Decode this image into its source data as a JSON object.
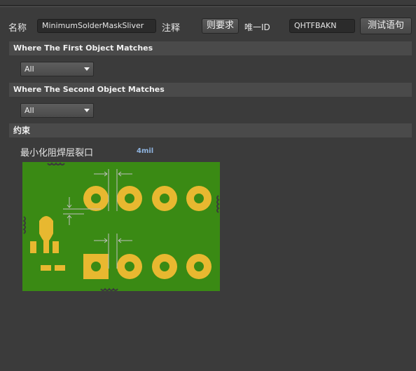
{
  "header": {
    "name_label": "名称",
    "name_value": "MinimumSolderMaskSliver",
    "comment_label": "注释",
    "rule_button": "则要求",
    "unique_id_label": "唯一ID",
    "unique_id_value": "QHTFBAKN",
    "test_button": "测试语句"
  },
  "first_object": {
    "title": "Where The First Object Matches",
    "selected": "All"
  },
  "second_object": {
    "title": "Where The Second Object Matches",
    "selected": "All"
  },
  "constraints": {
    "title": "约束",
    "param_label": "最小化阻焊层裂口",
    "param_value": "4mil"
  },
  "colors": {
    "board": "#3a8a14",
    "copper": "#e8b830",
    "dimension_line": "#c0c0c0"
  }
}
